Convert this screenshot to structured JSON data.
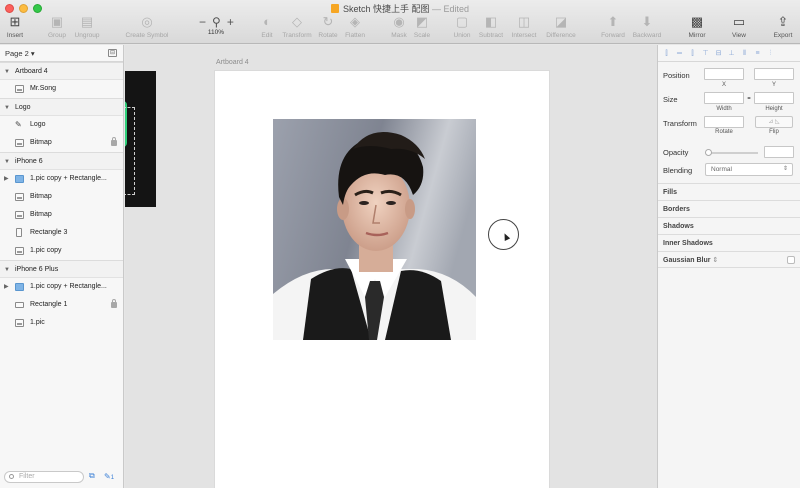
{
  "window": {
    "app_name": "Sketch",
    "document_title": "快捷上手 配图",
    "edited_label": "— Edited"
  },
  "toolbar": {
    "insert": "Insert",
    "group": "Group",
    "ungroup": "Ungroup",
    "create_symbol": "Create Symbol",
    "zoom_level": "110%",
    "edit": "Edit",
    "transform": "Transform",
    "rotate": "Rotate",
    "flatten": "Flatten",
    "mask": "Mask",
    "scale": "Scale",
    "union": "Union",
    "subtract": "Subtract",
    "intersect": "Intersect",
    "difference": "Difference",
    "forward": "Forward",
    "backward": "Backward",
    "mirror": "Mirror",
    "view": "View",
    "export": "Export"
  },
  "layers_panel": {
    "page_selector": "Page 2",
    "groups": [
      {
        "name": "Artboard 4",
        "items": [
          {
            "name": "Mr.Song",
            "icon": "bitmap-icon"
          }
        ]
      },
      {
        "name": "Logo",
        "items": [
          {
            "name": "Logo",
            "icon": "vector-icon"
          },
          {
            "name": "Bitmap",
            "icon": "bitmap-icon",
            "locked": true
          }
        ]
      },
      {
        "name": "iPhone 6",
        "items": [
          {
            "name": "1.pic copy + Rectangle...",
            "icon": "folder-icon",
            "expandable": true
          },
          {
            "name": "Bitmap",
            "icon": "bitmap-icon"
          },
          {
            "name": "Bitmap",
            "icon": "bitmap-icon"
          },
          {
            "name": "Rectangle 3",
            "icon": "rectangle-icon"
          },
          {
            "name": "1.pic copy",
            "icon": "bitmap-icon"
          }
        ]
      },
      {
        "name": "iPhone 6 Plus",
        "items": [
          {
            "name": "1.pic copy + Rectangle...",
            "icon": "folder-icon",
            "expandable": true
          },
          {
            "name": "Rectangle 1",
            "icon": "rectangle-icon",
            "locked": true
          },
          {
            "name": "1.pic",
            "icon": "bitmap-icon"
          }
        ]
      }
    ],
    "filter_placeholder": "Filter",
    "count_badge": "1"
  },
  "canvas": {
    "artboard_title": "Artboard 4"
  },
  "inspector": {
    "position_label": "Position",
    "x_label": "X",
    "y_label": "Y",
    "size_label": "Size",
    "width_label": "Width",
    "height_label": "Height",
    "transform_label": "Transform",
    "rotate_label": "Rotate",
    "flip_label": "Flip",
    "opacity_label": "Opacity",
    "blending_label": "Blending",
    "blending_value": "Normal",
    "sections": {
      "fills": "Fills",
      "borders": "Borders",
      "shadows": "Shadows",
      "inner_shadows": "Inner Shadows",
      "gaussian_blur": "Gaussian Blur"
    }
  },
  "colors": {
    "accent_blue": "#3a7fd6",
    "folder_blue": "#7fb4e6",
    "logo_green": "#2fd07a"
  }
}
